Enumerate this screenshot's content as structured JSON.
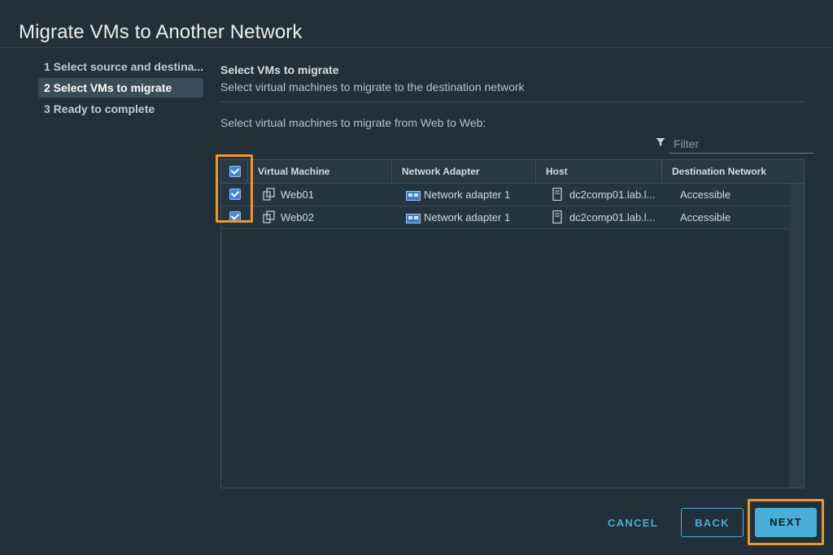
{
  "dialog": {
    "title": "Migrate VMs to Another Network"
  },
  "wizard": {
    "steps": [
      {
        "label": "1 Select source and destina...",
        "state": "completed"
      },
      {
        "label": "2 Select VMs to migrate",
        "state": "active"
      },
      {
        "label": "3 Ready to complete",
        "state": "pending"
      }
    ]
  },
  "main": {
    "title": "Select VMs to migrate",
    "description": "Select virtual machines to migrate to the destination network",
    "instruction": "Select virtual machines to migrate from Web to Web:"
  },
  "filter": {
    "placeholder": "Filter",
    "value": ""
  },
  "grid": {
    "columns": [
      "Virtual Machine",
      "Network Adapter",
      "Host",
      "Destination Network"
    ],
    "select_all_checked": true,
    "rows": [
      {
        "checked": true,
        "vm": "Web01",
        "adapter": "Network adapter 1",
        "host": "dc2comp01.lab.l...",
        "destination": "Accessible"
      },
      {
        "checked": true,
        "vm": "Web02",
        "adapter": "Network adapter 1",
        "host": "dc2comp01.lab.l...",
        "destination": "Accessible"
      }
    ]
  },
  "footer": {
    "cancel_label": "CANCEL",
    "back_label": "BACK",
    "next_label": "NEXT"
  },
  "colors": {
    "background": "#22303a",
    "accent": "#49afd9",
    "highlight": "#f0962b",
    "checkbox": "#3c86e0",
    "success": "#6cc24a"
  },
  "icons": {
    "step_done": "check-icon",
    "filter": "filter-icon",
    "vm": "vm-icon",
    "adapter": "network-adapter-icon",
    "host": "host-icon"
  }
}
